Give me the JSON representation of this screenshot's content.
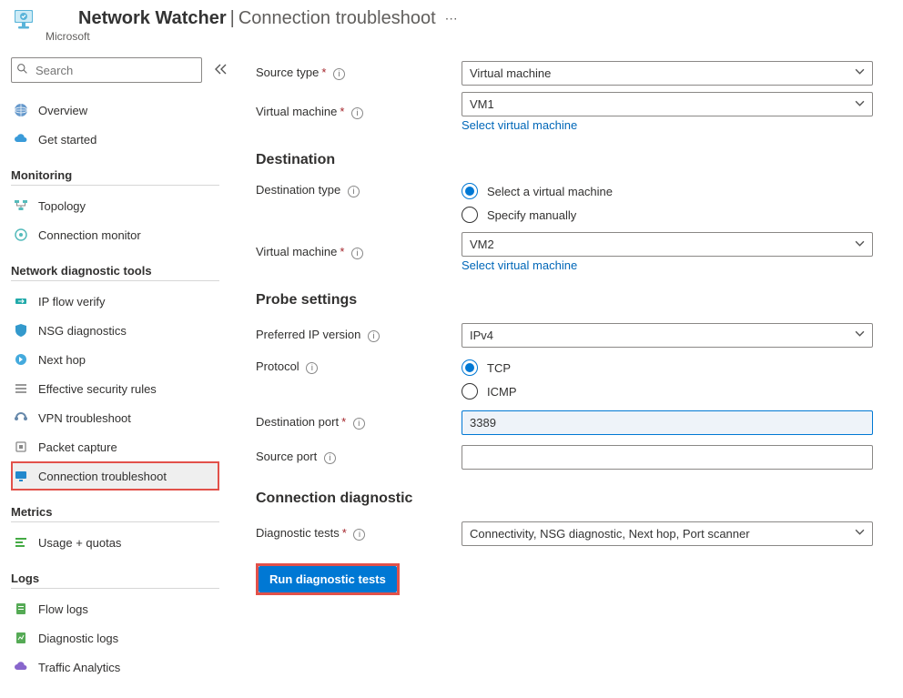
{
  "header": {
    "title_main": "Network Watcher",
    "title_sub": "Connection troubleshoot",
    "company": "Microsoft"
  },
  "sidebar": {
    "search_placeholder": "Search",
    "top_items": [
      {
        "label": "Overview"
      },
      {
        "label": "Get started"
      }
    ],
    "sections": [
      {
        "title": "Monitoring",
        "items": [
          {
            "label": "Topology"
          },
          {
            "label": "Connection monitor"
          }
        ]
      },
      {
        "title": "Network diagnostic tools",
        "items": [
          {
            "label": "IP flow verify"
          },
          {
            "label": "NSG diagnostics"
          },
          {
            "label": "Next hop"
          },
          {
            "label": "Effective security rules"
          },
          {
            "label": "VPN troubleshoot"
          },
          {
            "label": "Packet capture"
          },
          {
            "label": "Connection troubleshoot",
            "selected": true
          }
        ]
      },
      {
        "title": "Metrics",
        "items": [
          {
            "label": "Usage + quotas"
          }
        ]
      },
      {
        "title": "Logs",
        "items": [
          {
            "label": "Flow logs"
          },
          {
            "label": "Diagnostic logs"
          },
          {
            "label": "Traffic Analytics"
          }
        ]
      }
    ]
  },
  "form": {
    "source": {
      "source_type_label": "Source type",
      "source_type_value": "Virtual machine",
      "vm_label": "Virtual machine",
      "vm_value": "VM1",
      "select_vm_link": "Select virtual machine"
    },
    "destination": {
      "title": "Destination",
      "type_label": "Destination type",
      "opt_select_vm": "Select a virtual machine",
      "opt_specify": "Specify manually",
      "vm_label": "Virtual machine",
      "vm_value": "VM2",
      "select_vm_link": "Select virtual machine"
    },
    "probe": {
      "title": "Probe settings",
      "ip_version_label": "Preferred IP version",
      "ip_version_value": "IPv4",
      "protocol_label": "Protocol",
      "opt_tcp": "TCP",
      "opt_icmp": "ICMP",
      "dest_port_label": "Destination port",
      "dest_port_value": "3389",
      "src_port_label": "Source port",
      "src_port_value": ""
    },
    "diagnostic": {
      "title": "Connection diagnostic",
      "tests_label": "Diagnostic tests",
      "tests_value": "Connectivity, NSG diagnostic, Next hop, Port scanner",
      "run_button": "Run diagnostic tests"
    }
  }
}
